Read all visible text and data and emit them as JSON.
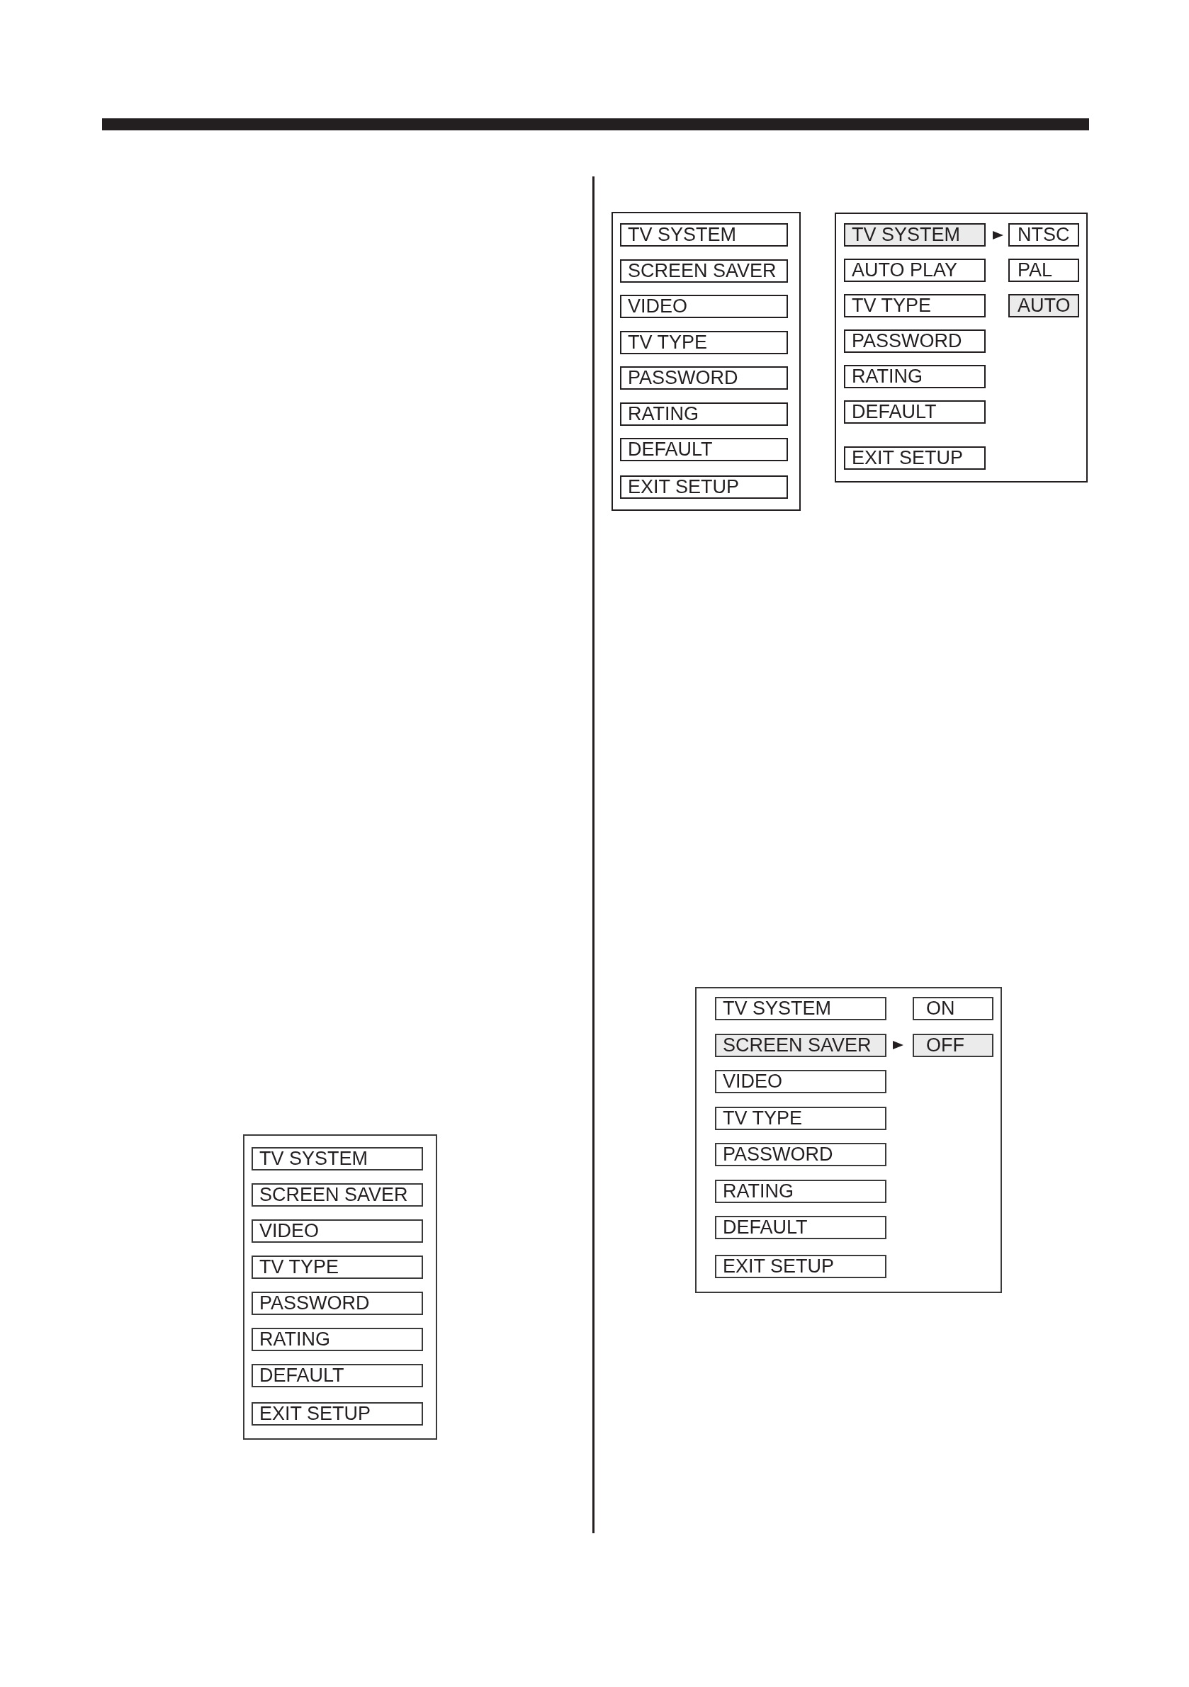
{
  "left_column": {
    "menu": {
      "items": [
        {
          "label": "TV SYSTEM",
          "selected": false
        },
        {
          "label": "SCREEN SAVER",
          "selected": false
        },
        {
          "label": "VIDEO",
          "selected": false
        },
        {
          "label": "TV TYPE",
          "selected": false
        },
        {
          "label": "PASSWORD",
          "selected": false
        },
        {
          "label": "RATING",
          "selected": false
        },
        {
          "label": "DEFAULT",
          "selected": false
        },
        {
          "label": "EXIT SETUP",
          "selected": false
        }
      ]
    }
  },
  "right_column": {
    "top_menus": [
      {
        "items": [
          {
            "label": "TV SYSTEM",
            "selected": false
          },
          {
            "label": "SCREEN SAVER",
            "selected": false
          },
          {
            "label": "VIDEO",
            "selected": false
          },
          {
            "label": "TV TYPE",
            "selected": false
          },
          {
            "label": "PASSWORD",
            "selected": false
          },
          {
            "label": "RATING",
            "selected": false
          },
          {
            "label": "DEFAULT",
            "selected": false
          },
          {
            "label": "EXIT SETUP",
            "selected": false
          }
        ]
      },
      {
        "items": [
          {
            "label": "TV SYSTEM",
            "selected": true
          },
          {
            "label": "AUTO PLAY",
            "selected": false
          },
          {
            "label": "TV TYPE",
            "selected": false
          },
          {
            "label": "PASSWORD",
            "selected": false
          },
          {
            "label": "RATING",
            "selected": false
          },
          {
            "label": "DEFAULT",
            "selected": false
          },
          {
            "label": "EXIT SETUP",
            "selected": false
          }
        ],
        "options": [
          {
            "label": "NTSC",
            "selected": false
          },
          {
            "label": "PAL",
            "selected": false
          },
          {
            "label": "AUTO",
            "selected": true
          }
        ]
      }
    ],
    "bottom_menu": {
      "items": [
        {
          "label": "TV SYSTEM",
          "selected": false
        },
        {
          "label": "SCREEN SAVER",
          "selected": true
        },
        {
          "label": "VIDEO",
          "selected": false
        },
        {
          "label": "TV TYPE",
          "selected": false
        },
        {
          "label": "PASSWORD",
          "selected": false
        },
        {
          "label": "RATING",
          "selected": false
        },
        {
          "label": "DEFAULT",
          "selected": false
        },
        {
          "label": "EXIT SETUP",
          "selected": false
        }
      ],
      "options": [
        {
          "label": "ON",
          "selected": false
        },
        {
          "label": "OFF",
          "selected": true
        }
      ]
    }
  }
}
